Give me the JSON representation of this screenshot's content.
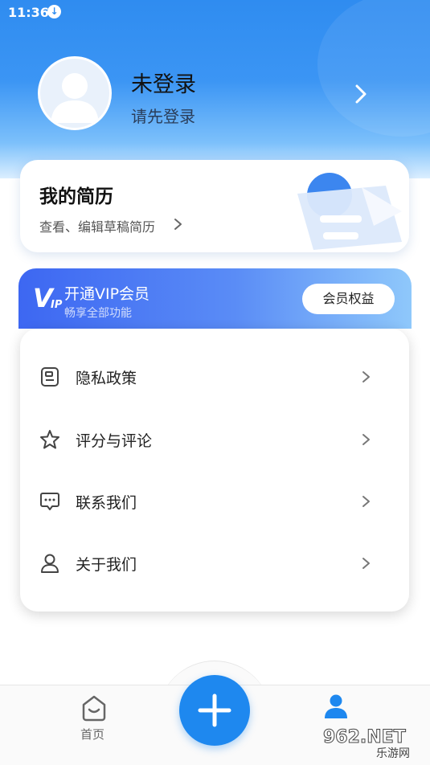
{
  "status_bar": {
    "time": "11:36",
    "download_icon": "download-icon"
  },
  "profile": {
    "name": "未登录",
    "subtitle": "请先登录",
    "avatar_icon": "person-icon",
    "chevron_icon": "chevron-right-icon"
  },
  "resume": {
    "title": "我的简历",
    "subtitle": "查看、编辑草稿简历",
    "illustration_icon": "resume-paper-icon"
  },
  "vip": {
    "logo": "V",
    "logo_suffix": "IP",
    "title": "开通VIP会员",
    "subtitle": "畅享全部功能",
    "button": "会员权益"
  },
  "menu": {
    "items": [
      {
        "label": "隐私政策",
        "icon": "document-icon"
      },
      {
        "label": "评分与评论",
        "icon": "star-icon"
      },
      {
        "label": "联系我们",
        "icon": "chat-bubble-icon"
      },
      {
        "label": "关于我们",
        "icon": "user-outline-icon"
      }
    ]
  },
  "tabbar": {
    "home_label": "首页",
    "home_icon": "home-icon",
    "add_icon": "plus-icon",
    "profile_icon": "person-filled-icon"
  },
  "watermark": {
    "text": "962.NET",
    "sub": "乐游网"
  },
  "colors": {
    "primary": "#1e88ef",
    "header_blue": "#2f8cf0",
    "vip_start": "#3d67f2",
    "vip_end": "#8fc8fb"
  }
}
